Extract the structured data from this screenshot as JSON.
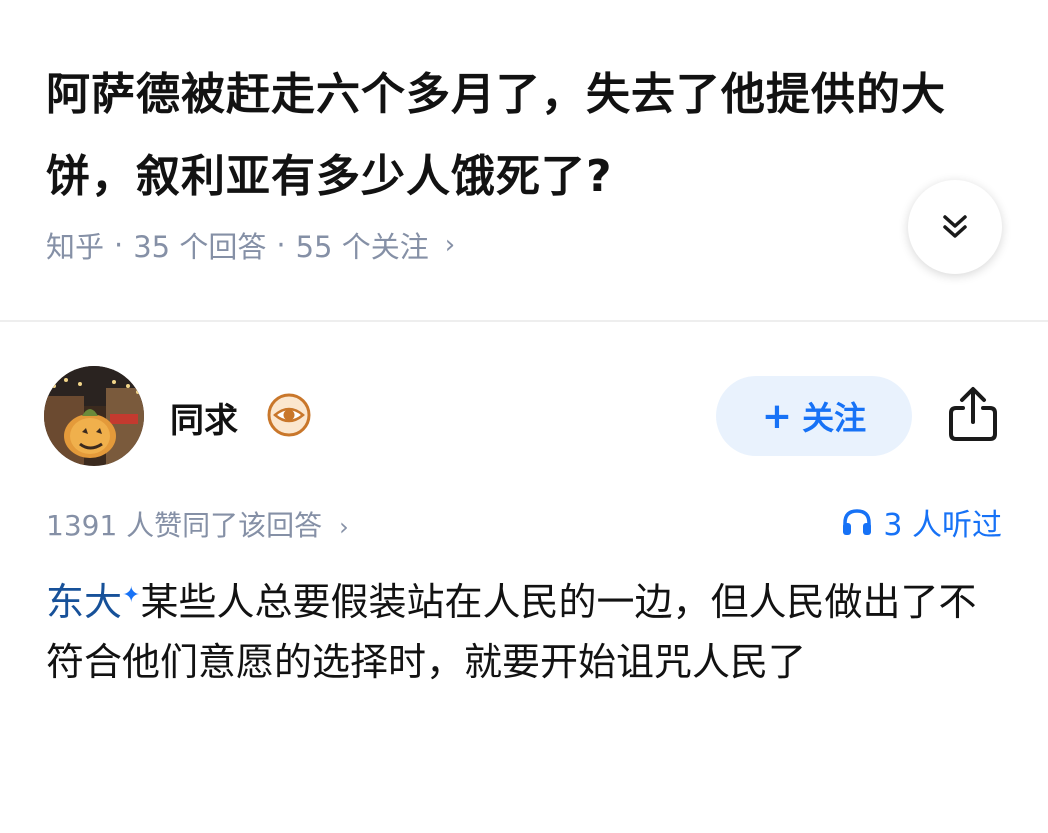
{
  "question": {
    "title": "阿萨德被赶走六个多月了，失去了他提供的大饼，叙利亚有多少人饿死了?",
    "source": "知乎",
    "separator": "·",
    "answers_count": "35 个回答",
    "followers_count": "55 个关注",
    "meta_chevron": "›"
  },
  "author": {
    "name": "同求",
    "follow_label": "关注",
    "follow_plus": "+"
  },
  "answer": {
    "votes": "1391 人赞同了该回答",
    "votes_chevron": "›",
    "listened": "3 人听过",
    "link_text": "东大",
    "link_mark": "✦",
    "body": "某些人总要假装站在人民的一边，但人民做出了不符合他们意愿的选择时，就要开始诅咒人民了"
  },
  "icons": {
    "expand": "chevron-double-down-icon",
    "badge": "eye-badge-icon",
    "share": "share-icon",
    "listen": "headphones-icon"
  },
  "colors": {
    "accent": "#1772f6",
    "link": "#175199",
    "meta": "#8590a6",
    "follow_bg": "#e9f2fd",
    "badge": "#c9772b"
  }
}
